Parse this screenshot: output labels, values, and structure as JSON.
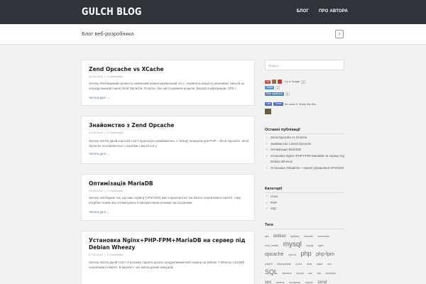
{
  "header": {
    "logo": "GULCH BLOG",
    "nav": [
      "БЛОГ",
      "ПРО АВТОРА"
    ]
  },
  "subheader": {
    "title": "Блог веб-розробника",
    "next_icon": "›"
  },
  "posts": [
    {
      "title": "Zend Opcache vs XCache",
      "date": "02.09.2014",
      "comments": "0 Comments",
      "excerpt": "Зеппоу Intel Вирішив провести невеликий навантажувальний тест і порівняти кількість можливих запитів за секунду використання Zend Opcache, XCache і без застосування модулю. Базова конфігурація: VPS c",
      "more": "Читати далі →"
    },
    {
      "title": "Знайомство з Zend Opcache",
      "date": "01.09.2014",
      "comments": "0 Comments",
      "excerpt": "Зеппоу Intel В даній короткій статті пропоную ознайомитись з \"опкод\" кешером для PHP – Zend Opcache. Zend Opcache поставляється з коробки з версії 5.5 у",
      "more": "Читати далі →"
    },
    {
      "title": "Оптимізація MariaDB",
      "date": "28.08.2014",
      "comments": "0 Comments",
      "excerpt": "Зеппоу Intel Буває так, що ваш сервер (VPS/VDS) має в арсеналі не так багато оперативної пам'яті, тому потрібно поміж них оптимізувати її використання різними застосунками.",
      "more": "Читати далі →"
    },
    {
      "title": "Установка Nginx+PHP-FPM+MariaDB на сервер під Debian Wheezy",
      "date": "27.08.2014",
      "comments": "0 Comments",
      "excerpt": "Зеппоу Intel В даній статті я розкажу підняти досить продуктивний веб-сервер на Debian 7 Wheezy з 512Мб оперативної пам'яті. В мережі є час вагом різних мануалів",
      "more": ""
    }
  ],
  "sidebar": {
    "search_placeholder": "Пошук...",
    "share": {
      "gplus_count": "+1",
      "gplus_text": "+1'у в Google",
      "gplus_badge": "0",
      "tweet": "Tweet",
      "tweet_count": "0",
      "vk": "Мне нравится",
      "vk_count": "5",
      "fb_like": "Like",
      "fb_share": "Share",
      "fb_text": "No users it. Share like this."
    },
    "recent_title": "Останні публікації",
    "recent": [
      "Zend Opcache vs XCache",
      "Знайомство з Zend Opcache",
      "Оптимізація MariaDB",
      "Установка Nginx+PHP-FPM+MariaDB на сервер під Debian Wheezy",
      "Установка Virtualmin – панелі управління VPS/VDS"
    ],
    "categories_title": "Категорії",
    "categories": [
      "Linux",
      "PHP",
      "SQL"
    ],
    "tags_title": "Теги",
    "tags": [
      {
        "t": "apt",
        "s": 4
      },
      {
        "t": "debian",
        "s": 6
      },
      {
        "t": "iptables",
        "s": 3.5
      },
      {
        "t": "mariadb",
        "s": 3.5
      },
      {
        "t": "memcache",
        "s": 3.5
      },
      {
        "t": "mod_rewrite",
        "s": 3.5
      },
      {
        "t": "mysql",
        "s": 10
      },
      {
        "t": "mysqli",
        "s": 3.5
      },
      {
        "t": "nginx",
        "s": 3.5
      },
      {
        "t": "opcache",
        "s": 7
      },
      {
        "t": "openvz",
        "s": 3.5
      },
      {
        "t": "php",
        "s": 9
      },
      {
        "t": "php-fpm",
        "s": 7
      },
      {
        "t": "php5.5",
        "s": 3.5
      },
      {
        "t": "phpmyadmin",
        "s": 3.5
      },
      {
        "t": "proxy",
        "s": 3.5
      },
      {
        "t": "redis",
        "s": 3.5
      },
      {
        "t": "regex",
        "s": 3.5
      },
      {
        "t": "sed",
        "s": 3.5
      },
      {
        "t": "SQL",
        "s": 9
      },
      {
        "t": "squeeze",
        "s": 3.5
      },
      {
        "t": "ubuntu",
        "s": 3.5
      },
      {
        "t": "ssh",
        "s": 3.5
      },
      {
        "t": "vds",
        "s": 3.5
      },
      {
        "t": "virtualmin",
        "s": 3.5
      },
      {
        "t": "vps",
        "s": 6
      },
      {
        "t": "wheezy",
        "s": 3.5
      },
      {
        "t": "wordpress",
        "s": 3.5
      },
      {
        "t": "xcache",
        "s": 3.5
      },
      {
        "t": "zend",
        "s": 6
      }
    ]
  },
  "colors": {
    "topbar": "#2f343b",
    "link": "#3a7fc1",
    "gplus": "#dd4b39",
    "twitter": "#3d9fd8",
    "vk": "#5b7fa6",
    "facebook": "#4c69ba"
  }
}
